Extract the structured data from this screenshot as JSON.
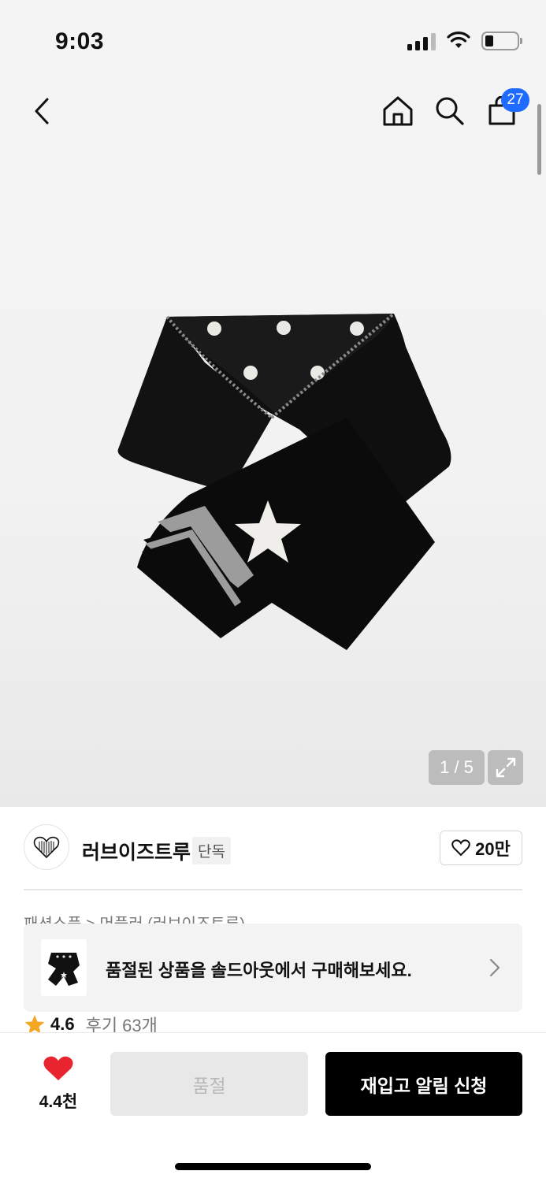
{
  "status_bar": {
    "time": "9:03"
  },
  "header": {
    "cart_count": "27"
  },
  "gallery": {
    "counter": "1 / 5"
  },
  "brand": {
    "logo_text": "LOVEISTRUE",
    "name": "러브이즈트루",
    "tag": "단독",
    "like_count": "20만"
  },
  "category": {
    "breadcrumb": "패션소품 > 머플러 (러브이즈트루)"
  },
  "soldout_banner": {
    "text": "품절된 상품을 솔드아웃에서 구매해보세요."
  },
  "rating": {
    "score": "4.6",
    "reviews": "후기 63개"
  },
  "bottom_bar": {
    "favorite_count": "4.4천",
    "soldout_label": "품절",
    "restock_label": "재입고 알림 신청"
  },
  "colors": {
    "badge": "#1f6bff",
    "heart": "#e8252e",
    "star": "#f5a623",
    "primary_button": "#000000"
  }
}
